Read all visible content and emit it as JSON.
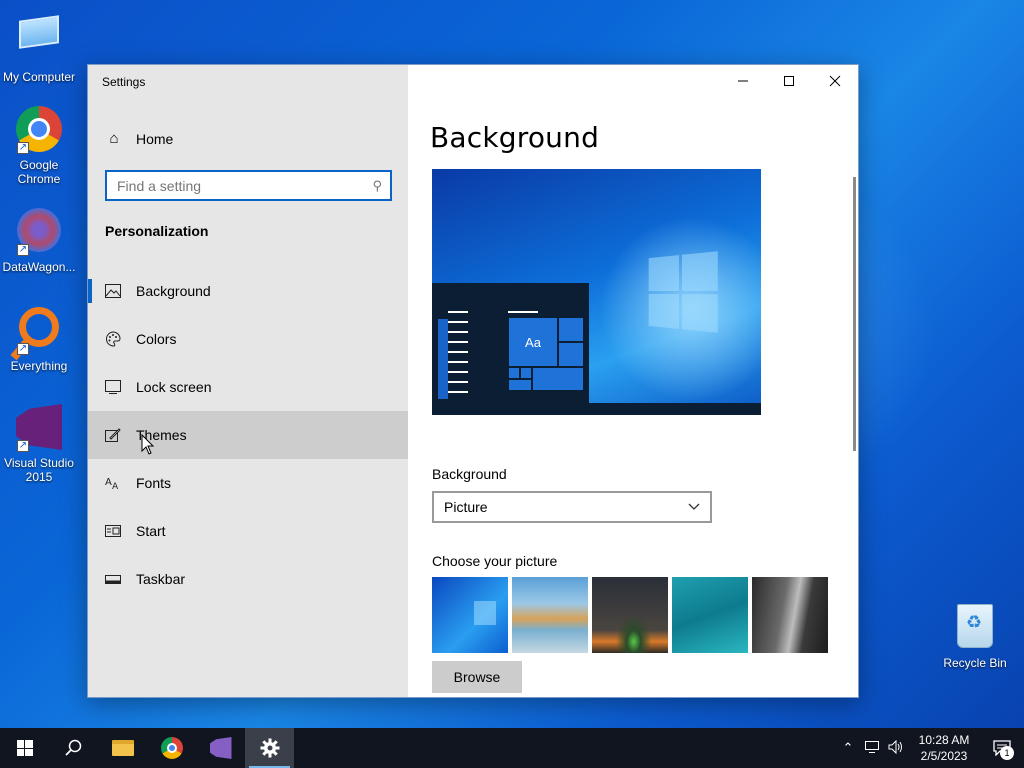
{
  "desktop": {
    "icons": [
      {
        "label": "My Computer"
      },
      {
        "label": "Google Chrome"
      },
      {
        "label": "DataWagon..."
      },
      {
        "label": "Everything"
      },
      {
        "label": "Visual Studio 2015"
      },
      {
        "label": "Recycle Bin"
      }
    ]
  },
  "window": {
    "title": "Settings",
    "controls": {
      "minimize": "─",
      "maximize": "☐",
      "close": "✕"
    }
  },
  "sidebar": {
    "home_label": "Home",
    "search_placeholder": "Find a setting",
    "section_title": "Personalization",
    "items": [
      {
        "label": "Background",
        "icon": "picture-icon",
        "glyph": "🖼"
      },
      {
        "label": "Colors",
        "icon": "palette-icon",
        "glyph": "🎨"
      },
      {
        "label": "Lock screen",
        "icon": "lock-screen-icon",
        "glyph": "▭"
      },
      {
        "label": "Themes",
        "icon": "brush-icon",
        "glyph": "✎"
      },
      {
        "label": "Fonts",
        "icon": "fonts-icon",
        "glyph": "A"
      },
      {
        "label": "Start",
        "icon": "start-tiles-icon",
        "glyph": "▦"
      },
      {
        "label": "Taskbar",
        "icon": "taskbar-icon",
        "glyph": "▬"
      }
    ],
    "selected": "Background",
    "hovered": "Themes"
  },
  "content": {
    "page_title": "Background",
    "preview_tile_text": "Aa",
    "background_label": "Background",
    "background_value": "Picture",
    "choose_label": "Choose your picture",
    "browse_label": "Browse"
  },
  "taskbar": {
    "clock_time": "10:28 AM",
    "clock_date": "2/5/2023",
    "notification_count": "1"
  },
  "colors": {
    "accent": "#0a64c8",
    "sidebar_bg": "#e6e6e6",
    "hover_bg": "#cdcdcd",
    "taskbar_bg": "#101520"
  }
}
